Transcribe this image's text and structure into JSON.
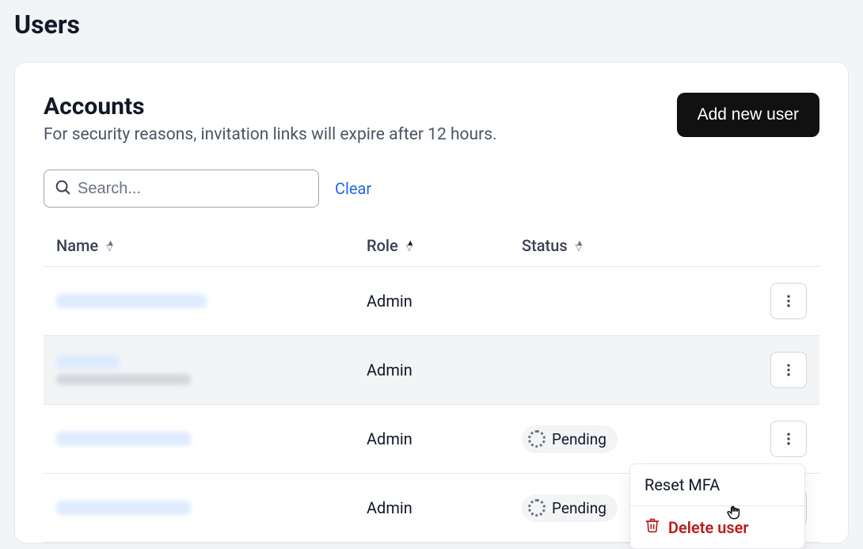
{
  "page": {
    "title": "Users"
  },
  "card": {
    "title": "Accounts",
    "subtitle": "For security reasons, invitation links will expire after 12 hours.",
    "add_button": "Add new user"
  },
  "search": {
    "placeholder": "Search...",
    "value": "",
    "clear_label": "Clear"
  },
  "columns": {
    "name": "Name",
    "role": "Role",
    "status": "Status",
    "sort_active": "role_asc"
  },
  "rows": [
    {
      "role": "Admin",
      "status": null,
      "selected": false,
      "name_primary_w": 190,
      "name_secondary_w": 0
    },
    {
      "role": "Admin",
      "status": null,
      "selected": true,
      "name_primary_w": 80,
      "name_secondary_w": 170
    },
    {
      "role": "Admin",
      "status": "Pending",
      "selected": false,
      "name_primary_w": 170,
      "name_secondary_w": 0
    },
    {
      "role": "Admin",
      "status": "Pending",
      "selected": false,
      "name_primary_w": 170,
      "name_secondary_w": 0
    }
  ],
  "menu": {
    "reset_mfa": "Reset MFA",
    "delete_user": "Delete user"
  },
  "icons": {
    "search": "search-icon",
    "kebab": "more-vertical-icon",
    "trash": "trash-icon",
    "spinner": "pending-spinner"
  }
}
